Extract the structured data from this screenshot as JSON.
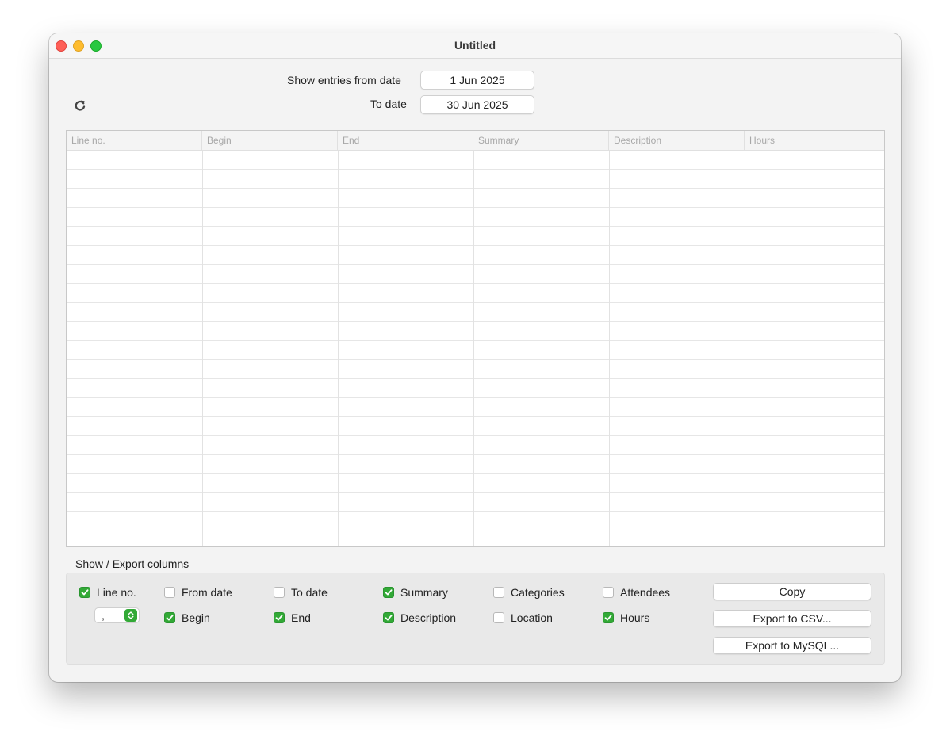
{
  "window": {
    "title": "Untitled"
  },
  "filters": {
    "from_label": "Show entries from date",
    "from_value": "1 Jun 2025",
    "to_label": "To date",
    "to_value": "30 Jun 2025"
  },
  "table": {
    "columns": [
      "Line no.",
      "Begin",
      "End",
      "Summary",
      "Description",
      "Hours"
    ],
    "rows": []
  },
  "export_section": {
    "title": "Show / Export columns",
    "separator": ",",
    "checkboxes": [
      {
        "label": "Line no.",
        "checked": true
      },
      {
        "label": "From date",
        "checked": false
      },
      {
        "label": "To date",
        "checked": false
      },
      {
        "label": "Summary",
        "checked": true
      },
      {
        "label": "Categories",
        "checked": false
      },
      {
        "label": "Attendees",
        "checked": false
      },
      {
        "label": "Begin",
        "checked": true
      },
      {
        "label": "End",
        "checked": true
      },
      {
        "label": "Description",
        "checked": true
      },
      {
        "label": "Location",
        "checked": false
      },
      {
        "label": "Hours",
        "checked": true
      }
    ],
    "buttons": {
      "copy": "Copy",
      "export_csv": "Export to CSV...",
      "export_mysql": "Export to MySQL..."
    }
  },
  "colors": {
    "accent_green": "#32a936"
  }
}
